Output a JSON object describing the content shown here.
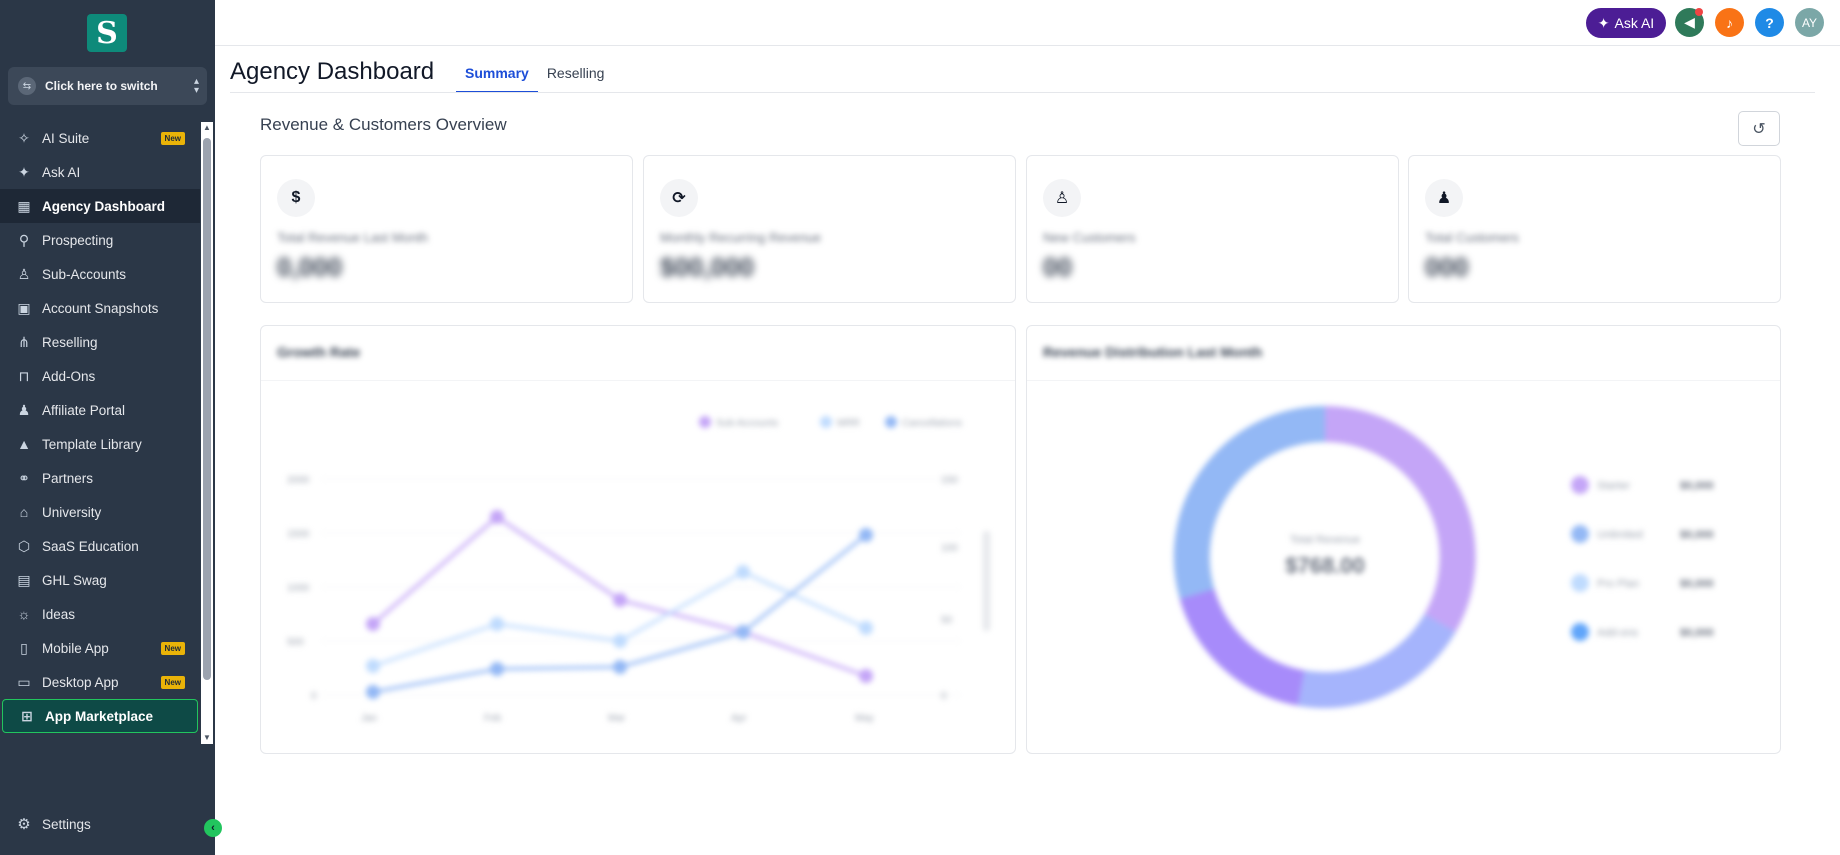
{
  "sidebar": {
    "logo_letter": "S",
    "switcher_label": "Click here to switch",
    "items": [
      {
        "label": "AI Suite",
        "icon": "sparkle-icon",
        "badge": "New"
      },
      {
        "label": "Ask AI",
        "icon": "sparkle-icon"
      },
      {
        "label": "Agency Dashboard",
        "icon": "dashboard-icon"
      },
      {
        "label": "Prospecting",
        "icon": "user-search-icon"
      },
      {
        "label": "Sub-Accounts",
        "icon": "user-icon"
      },
      {
        "label": "Account Snapshots",
        "icon": "snapshot-icon"
      },
      {
        "label": "Reselling",
        "icon": "network-icon"
      },
      {
        "label": "Add-Ons",
        "icon": "bag-icon"
      },
      {
        "label": "Affiliate Portal",
        "icon": "users-icon"
      },
      {
        "label": "Template Library",
        "icon": "shapes-icon"
      },
      {
        "label": "Partners",
        "icon": "handshake-icon"
      },
      {
        "label": "University",
        "icon": "graduation-cap-icon"
      },
      {
        "label": "SaaS Education",
        "icon": "cubes-icon"
      },
      {
        "label": "GHL Swag",
        "icon": "store-icon"
      },
      {
        "label": "Ideas",
        "icon": "lightbulb-icon"
      },
      {
        "label": "Mobile App",
        "icon": "mobile-icon",
        "badge": "New"
      },
      {
        "label": "Desktop App",
        "icon": "desktop-icon",
        "badge": "New"
      },
      {
        "label": "App Marketplace",
        "icon": "grid-icon"
      }
    ],
    "settings_label": "Settings"
  },
  "topbar": {
    "ask_ai_label": "Ask AI",
    "help_label": "?",
    "avatar_initials": "AY"
  },
  "header": {
    "title": "Agency Dashboard",
    "tabs": [
      {
        "label": "Summary"
      },
      {
        "label": "Reselling"
      }
    ]
  },
  "overview": {
    "title": "Revenue & Customers Overview",
    "cards": [
      {
        "icon": "dollar-icon",
        "label": "Total Revenue Last Month",
        "value": "0,000"
      },
      {
        "icon": "refresh-cycle-icon",
        "label": "Monthly Recurring Revenue",
        "value": "$00,000"
      },
      {
        "icon": "user-plus-icon",
        "label": "New Customers",
        "value": "00"
      },
      {
        "icon": "users-icon",
        "label": "Total Customers",
        "value": "000"
      }
    ]
  },
  "growth_chart": {
    "title": "Growth Rate",
    "legend": [
      "Sub-Accounts",
      "MRR",
      "Cancellations"
    ],
    "y_ticks": [
      "2000",
      "1500",
      "1000",
      "500",
      "0"
    ],
    "y2_ticks": [
      "150",
      "100",
      "50",
      "0"
    ],
    "x_ticks": [
      "Jan",
      "Feb",
      "Mar",
      "Apr",
      "May"
    ]
  },
  "revenue_chart": {
    "title": "Revenue Distribution Last Month",
    "center_label": "Total Revenue",
    "center_value": "$768.00",
    "legend": [
      {
        "label": "Starter",
        "value": "$0,000",
        "color": "#c4a5f7"
      },
      {
        "label": "Unlimited",
        "value": "$0,000",
        "color": "#93b8f5"
      },
      {
        "label": "Pro Plan",
        "value": "$0,000",
        "color": "#bfdbfe"
      },
      {
        "label": "Add-ons",
        "value": "$0,000",
        "color": "#60a5fa"
      }
    ]
  },
  "colors": {
    "sidebar_bg": "#2b3747",
    "accent": "#1d4ed8",
    "active_item_bg": "#1e2836",
    "marketplace_highlight": "#22c55e"
  }
}
